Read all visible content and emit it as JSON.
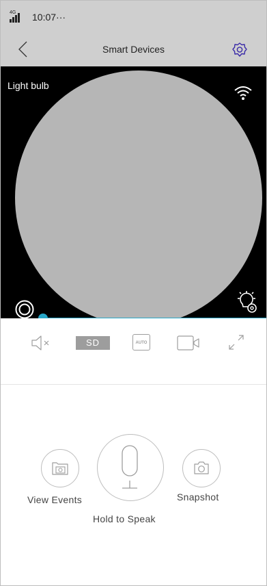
{
  "status_bar": {
    "network": "4G",
    "time": "10:07···"
  },
  "nav": {
    "title": "Smart Devices"
  },
  "video": {
    "device_label": "Light bulb",
    "slider_level": 0.0
  },
  "toolbar": {
    "quality_label": "SD",
    "auto_label": "AUTO"
  },
  "controls": {
    "view_events_label": "View Events",
    "hold_to_speak_label": "Hold to Speak",
    "snapshot_label": "Snapshot"
  },
  "colors": {
    "accent": "#27a7c8",
    "bar_bg": "#cfcfcf",
    "icon_gray": "#9d9d9d"
  },
  "icons": [
    "signal-icon",
    "back-arrow-icon",
    "settings-gear-icon",
    "wifi-icon",
    "record-icon",
    "light-settings-icon",
    "mute-icon",
    "hd-sd-icon",
    "auto-icon",
    "video-record-icon",
    "fullscreen-icon",
    "photo-folder-icon",
    "microphone-icon",
    "camera-icon"
  ]
}
